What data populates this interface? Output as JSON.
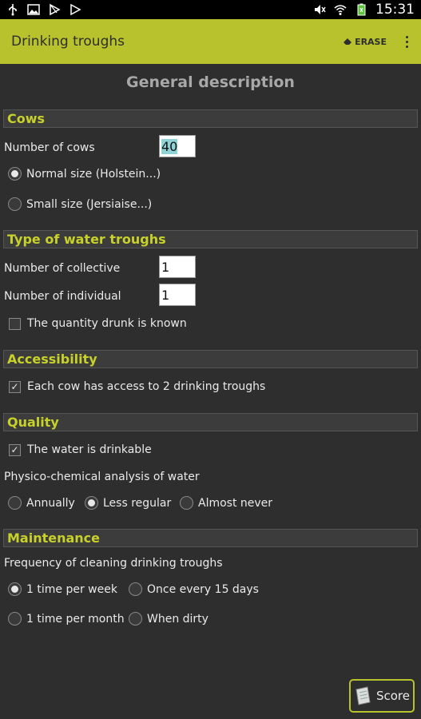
{
  "status_bar": {
    "time": "15:31"
  },
  "action_bar": {
    "title": "Drinking troughs",
    "erase_label": "ERASE"
  },
  "page_title": "General description",
  "sections": {
    "cows": {
      "title": "Cows",
      "number_label": "Number of cows",
      "number_value": "40",
      "size_options": [
        "Normal size (Holstein...)",
        "Small size (Jersiaise...)"
      ],
      "size_selected": 0
    },
    "troughs": {
      "title": "Type of water troughs",
      "collective_label": "Number of collective",
      "collective_value": "1",
      "individual_label": "Number of individual",
      "individual_value": "1",
      "known_label": "The quantity drunk is known",
      "known_checked": false
    },
    "accessibility": {
      "title": "Accessibility",
      "access_label": "Each cow has access to 2 drinking troughs",
      "access_checked": true
    },
    "quality": {
      "title": "Quality",
      "drinkable_label": "The water is drinkable",
      "drinkable_checked": true,
      "analysis_label": "Physico-chemical analysis of water",
      "analysis_options": [
        "Annually",
        "Less regular",
        "Almost never"
      ],
      "analysis_selected": 1
    },
    "maintenance": {
      "title": "Maintenance",
      "frequency_label": "Frequency of cleaning drinking troughs",
      "frequency_options": [
        "1 time per week",
        "Once every 15 days",
        "1 time per month",
        "When dirty"
      ],
      "frequency_selected": 0
    }
  },
  "score_label": "Score",
  "colors": {
    "accent": "#b8c22d",
    "section_text": "#c8d12a",
    "background": "#2e2e2e"
  }
}
